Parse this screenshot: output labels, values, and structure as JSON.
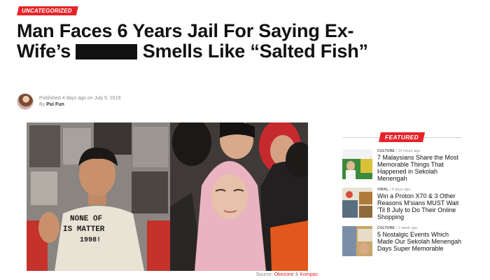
{
  "article": {
    "category": "UNCATEGORIZED",
    "headline_part1": "Man Faces 6 Years Jail For Saying Ex-Wife’s",
    "headline_part2": "Smells Like “Salted Fish”",
    "published": "Published 4 days ago on July 5, 2019",
    "by_prefix": "By",
    "author": "Pui Fun",
    "photo_shirt_text": [
      "NONE OF",
      "IS MATTER",
      "1998!"
    ],
    "source_prefix": "Source:",
    "source_1": "Okezone",
    "source_sep": "&",
    "source_2": "Kompas"
  },
  "sidebar": {
    "featured_label": "FEATURED",
    "items": [
      {
        "category": "CULTURE",
        "time": "14 hours ago",
        "title": "7 Malaysians Share the Most Memorable Things That Happened in Sekolah Menengah"
      },
      {
        "category": "VIRAL",
        "time": "4 days ago",
        "title": "Win a Proton X70 & 3 Other Reasons M'sians MUST Wait 'Til 8 July to Do Their Online Shopping"
      },
      {
        "category": "CULTURE",
        "time": "1 week ago",
        "title": "5 Nostalgic Events Which Made Our Sekolah Menengah Days Super Memorable"
      }
    ]
  },
  "colors": {
    "accent": "#e5242a",
    "meta_text": "#888888",
    "headline_text": "#111111"
  }
}
